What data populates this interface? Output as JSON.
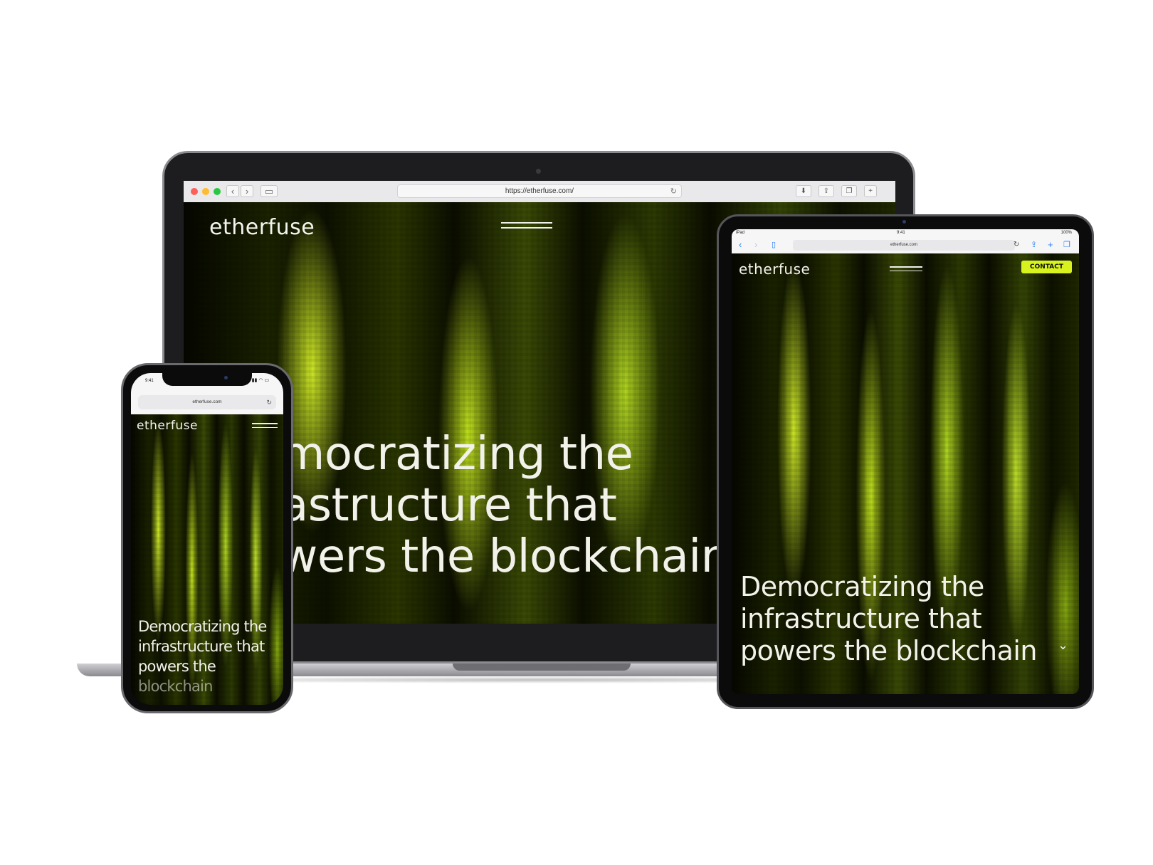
{
  "brand": "etherfuse",
  "hero": {
    "line1": "Democratizing the",
    "line2": "infrastructure that",
    "line3": "powers the blockchain"
  },
  "laptop": {
    "url": "https://etherfuse.com/",
    "line1": "mocratizing the",
    "line2": "astructure that",
    "line3": "wers the blockchain"
  },
  "tablet": {
    "status_left": "iPad",
    "status_time": "9:41",
    "status_battery": "100%",
    "url": "etherfuse.com",
    "contact_label": "CONTACT"
  },
  "phone": {
    "status_time": "9:41",
    "url": "etherfuse.com",
    "line3": "powers the",
    "line4": "blockchain"
  },
  "colors": {
    "accent": "#d7f21d",
    "dark": "#000000"
  }
}
